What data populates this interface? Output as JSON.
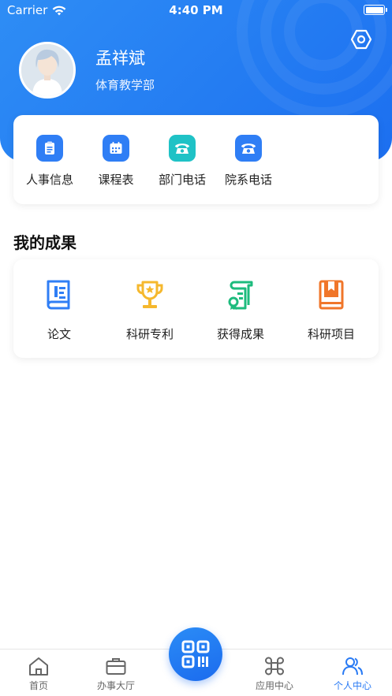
{
  "status_bar": {
    "carrier": "Carrier",
    "time": "4:40 PM"
  },
  "profile": {
    "name": "孟祥斌",
    "department": "体育教学部"
  },
  "quick_actions": [
    {
      "label": "人事信息",
      "icon": "clipboard-icon",
      "color": "#2f7ef5"
    },
    {
      "label": "课程表",
      "icon": "calendar-icon",
      "color": "#2f7ef5"
    },
    {
      "label": "部门电话",
      "icon": "telephone-icon",
      "color": "#1fc2c6"
    },
    {
      "label": "院系电话",
      "icon": "telephone-icon",
      "color": "#2f7ef5"
    }
  ],
  "achievements": {
    "title": "我的成果",
    "items": [
      {
        "label": "论文",
        "icon": "paper-document-icon",
        "color": "#2f7ef5"
      },
      {
        "label": "科研专利",
        "icon": "trophy-icon",
        "color": "#f5b82e"
      },
      {
        "label": "获得成果",
        "icon": "certificate-scroll-icon",
        "color": "#1dbb7d"
      },
      {
        "label": "科研项目",
        "icon": "project-book-icon",
        "color": "#f0762a"
      }
    ]
  },
  "tabbar": {
    "items": [
      {
        "label": "首页",
        "icon": "home-icon",
        "active": false
      },
      {
        "label": "办事大厅",
        "icon": "briefcase-icon",
        "active": false
      },
      {
        "label": "应用中心",
        "icon": "command-icon",
        "active": false
      },
      {
        "label": "个人中心",
        "icon": "users-icon",
        "active": true
      }
    ],
    "center_icon": "qr-scan-icon",
    "active_color": "#2a7bf4"
  }
}
